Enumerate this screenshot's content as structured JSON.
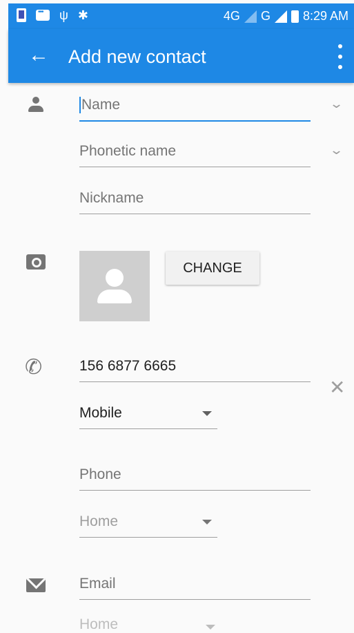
{
  "status_bar": {
    "network_4g": "4G",
    "network_g": "G",
    "time": "8:29 AM"
  },
  "toolbar": {
    "title": "Add new contact"
  },
  "name_section": {
    "name_placeholder": "Name",
    "phonetic_placeholder": "Phonetic name",
    "nickname_placeholder": "Nickname"
  },
  "photo_section": {
    "change_label": "CHANGE"
  },
  "phone_section": {
    "phone_value": "156 6877 6665",
    "phone_type": "Mobile",
    "phone2_placeholder": "Phone",
    "phone2_type": "Home"
  },
  "email_section": {
    "email_placeholder": "Email",
    "email_type": "Home"
  },
  "colors": {
    "accent": "#1e88e5",
    "background": "#fafafa"
  }
}
